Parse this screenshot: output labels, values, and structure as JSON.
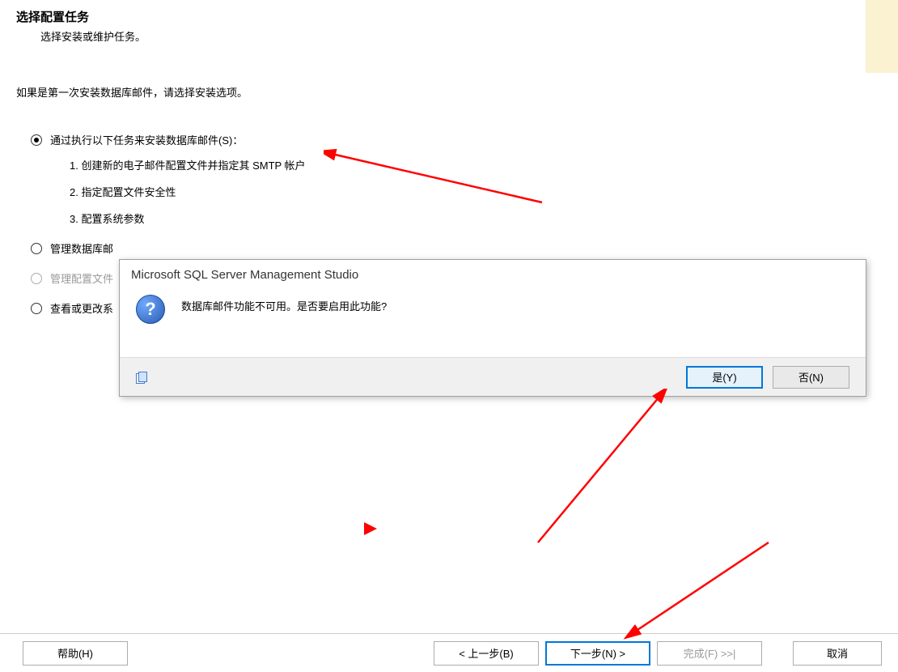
{
  "header": {
    "title": "选择配置任务",
    "subtitle": "选择安装或维护任务。"
  },
  "intro": "如果是第一次安装数据库邮件，请选择安装选项。",
  "options": {
    "opt1": {
      "label": "通过执行以下任务来安装数据库邮件(S)：",
      "sub1": "1.  创建新的电子邮件配置文件并指定其 SMTP 帐户",
      "sub2": "2.  指定配置文件安全性",
      "sub3": "3.  配置系统参数"
    },
    "opt2": {
      "label": "管理数据库邮"
    },
    "opt3": {
      "label": "管理配置文件"
    },
    "opt4": {
      "label": "查看或更改系"
    }
  },
  "dialog": {
    "title": "Microsoft SQL Server Management Studio",
    "icon_char": "?",
    "message": "数据库邮件功能不可用。是否要启用此功能?",
    "yes": "是(Y)",
    "no": "否(N)"
  },
  "wizard_footer": {
    "help": "帮助(H)",
    "back": "< 上一步(B)",
    "next": "下一步(N)  >",
    "finish": "完成(F) >>|",
    "cancel": "取消"
  }
}
